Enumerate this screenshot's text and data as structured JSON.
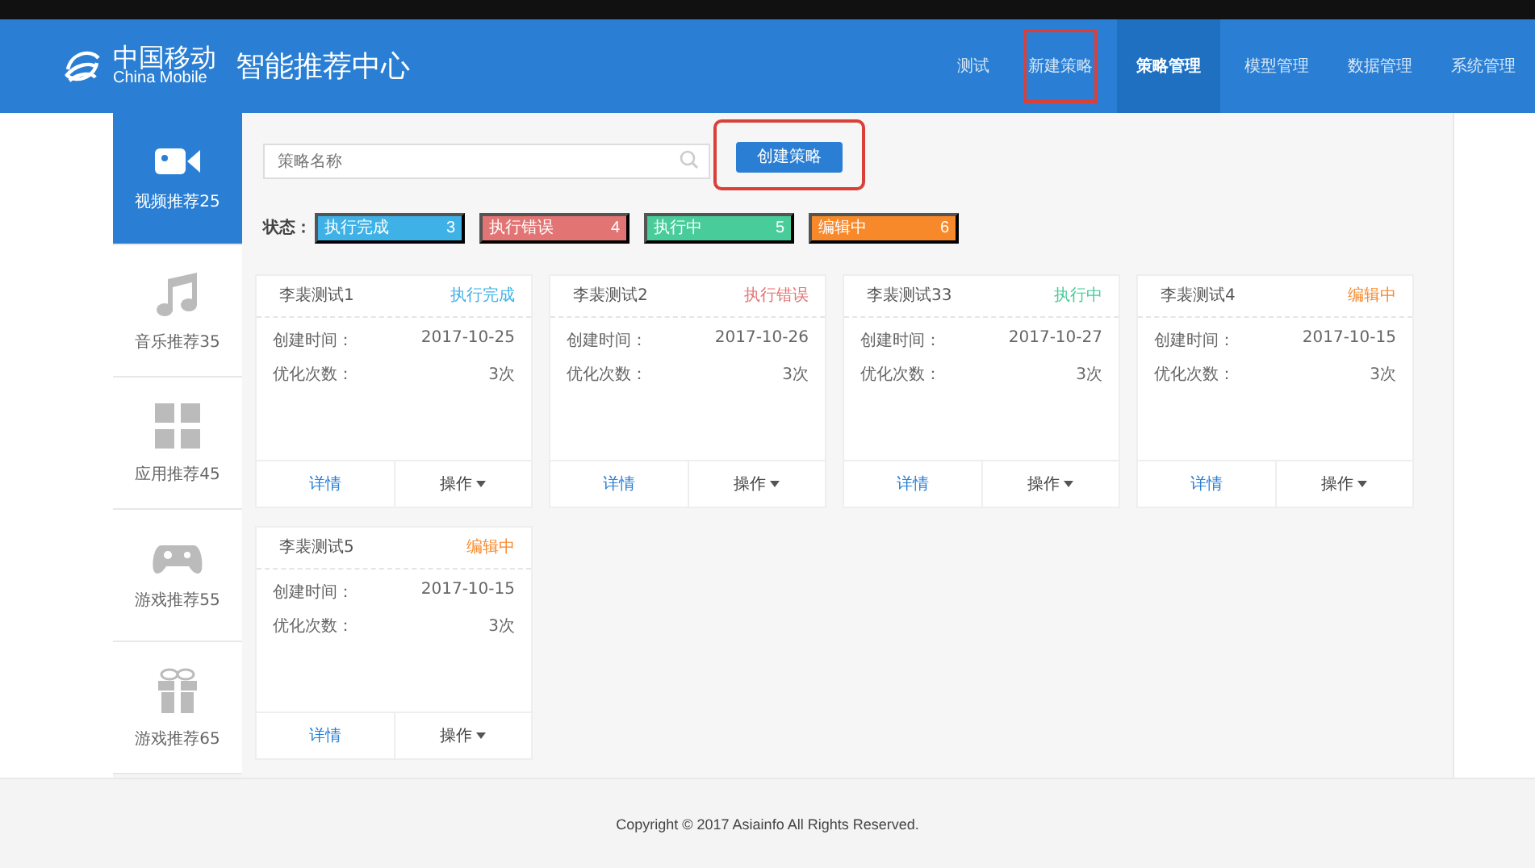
{
  "header": {
    "logo_cn": "中国移动",
    "logo_en": "China Mobile",
    "title": "智能推荐中心"
  },
  "nav": [
    {
      "label": "测试",
      "selected": false,
      "highlighted": false
    },
    {
      "label": "新建策略",
      "selected": false,
      "highlighted": true
    },
    {
      "label": "策略管理",
      "selected": true,
      "highlighted": false
    },
    {
      "label": "模型管理",
      "selected": false,
      "highlighted": false
    },
    {
      "label": "数据管理",
      "selected": false,
      "highlighted": false
    },
    {
      "label": "系统管理",
      "selected": false,
      "highlighted": false
    }
  ],
  "sidebar": {
    "items": [
      {
        "kind": "video",
        "label": "视频推荐25",
        "selected": true
      },
      {
        "kind": "music",
        "label": "音乐推荐35",
        "selected": false
      },
      {
        "kind": "apps",
        "label": "应用推荐45",
        "selected": false
      },
      {
        "kind": "game",
        "label": "游戏推荐55",
        "selected": false
      },
      {
        "kind": "gift",
        "label": "游戏推荐65",
        "selected": false
      }
    ]
  },
  "search": {
    "placeholder": "策略名称"
  },
  "create_button": {
    "label": "创建策略",
    "highlighted": true
  },
  "status_filter": {
    "label": "状态：",
    "badges": [
      {
        "label": "执行完成",
        "count": "3",
        "color": "#3eb1e6"
      },
      {
        "label": "执行错误",
        "count": "4",
        "color": "#e37474"
      },
      {
        "label": "执行中",
        "count": "5",
        "color": "#47cc9a"
      },
      {
        "label": "编辑中",
        "count": "6",
        "color": "#f7892b"
      }
    ]
  },
  "cards": [
    {
      "name": "李裴测试1",
      "status": "执行完成",
      "color": "#3eb1e6",
      "created_label": "创建时间：",
      "created": "2017-10-25",
      "count_label": "优化次数：",
      "count": "3次",
      "details": "详情",
      "actions": "操作"
    },
    {
      "name": "李裴测试2",
      "status": "执行错误",
      "color": "#e37474",
      "created_label": "创建时间：",
      "created": "2017-10-26",
      "count_label": "优化次数：",
      "count": "3次",
      "details": "详情",
      "actions": "操作"
    },
    {
      "name": "李裴测试33",
      "status": "执行中",
      "color": "#47cc9a",
      "created_label": "创建时间：",
      "created": "2017-10-27",
      "count_label": "优化次数：",
      "count": "3次",
      "details": "详情",
      "actions": "操作"
    },
    {
      "name": "李裴测试4",
      "status": "编辑中",
      "color": "#f7892b",
      "created_label": "创建时间：",
      "created": "2017-10-15",
      "count_label": "优化次数：",
      "count": "3次",
      "details": "详情",
      "actions": "操作"
    },
    {
      "name": "李裴测试5",
      "status": "编辑中",
      "color": "#f7892b",
      "created_label": "创建时间：",
      "created": "2017-10-15",
      "count_label": "优化次数：",
      "count": "3次",
      "details": "详情",
      "actions": "操作"
    }
  ],
  "footer": {
    "copyright": "Copyright © 2017 Asiainfo All Rights Reserved."
  }
}
